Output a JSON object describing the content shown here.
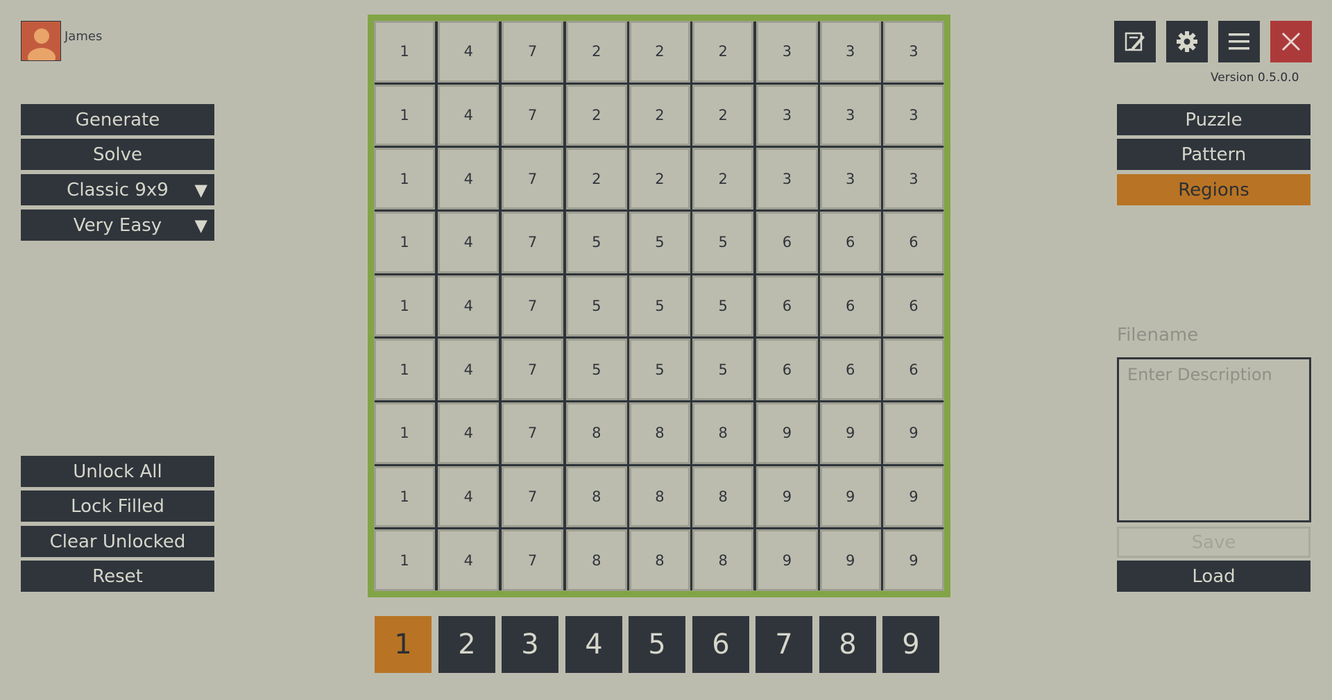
{
  "user": {
    "name": "James",
    "avatar_icon": "user-avatar-icon"
  },
  "version": "Version 0.5.0.0",
  "left_menu": {
    "generate": "Generate",
    "solve": "Solve",
    "grid_type": "Classic 9x9",
    "difficulty": "Very Easy",
    "dropdown_arrow": "▼",
    "unlock_all": "Unlock All",
    "lock_filled": "Lock Filled",
    "clear_unlocked": "Clear Unlocked",
    "reset": "Reset"
  },
  "right_menu": {
    "puzzle": "Puzzle",
    "pattern": "Pattern",
    "regions": "Regions",
    "active_mode": "Regions"
  },
  "toolbar_icons": [
    "edit-icon",
    "gear-icon",
    "hamburger-menu-icon",
    "close-icon"
  ],
  "file_panel": {
    "filename_label": "Filename",
    "description_placeholder": "Enter Description",
    "description_value": "",
    "save": "Save",
    "load": "Load"
  },
  "board": {
    "cells": [
      [
        1,
        4,
        7,
        2,
        2,
        2,
        3,
        3,
        3
      ],
      [
        1,
        4,
        7,
        2,
        2,
        2,
        3,
        3,
        3
      ],
      [
        1,
        4,
        7,
        2,
        2,
        2,
        3,
        3,
        3
      ],
      [
        1,
        4,
        7,
        5,
        5,
        5,
        6,
        6,
        6
      ],
      [
        1,
        4,
        7,
        5,
        5,
        5,
        6,
        6,
        6
      ],
      [
        1,
        4,
        7,
        5,
        5,
        5,
        6,
        6,
        6
      ],
      [
        1,
        4,
        7,
        8,
        8,
        8,
        9,
        9,
        9
      ],
      [
        1,
        4,
        7,
        8,
        8,
        8,
        9,
        9,
        9
      ],
      [
        1,
        4,
        7,
        8,
        8,
        8,
        9,
        9,
        9
      ]
    ]
  },
  "numpad": {
    "digits": [
      "1",
      "2",
      "3",
      "4",
      "5",
      "6",
      "7",
      "8",
      "9"
    ],
    "selected": "1"
  },
  "colors": {
    "background": "#bcbcae",
    "button": "#30353c",
    "button_text": "#d6d6ca",
    "accent": "#b87424",
    "board_border": "#82a446",
    "close": "#ad3a3a"
  }
}
